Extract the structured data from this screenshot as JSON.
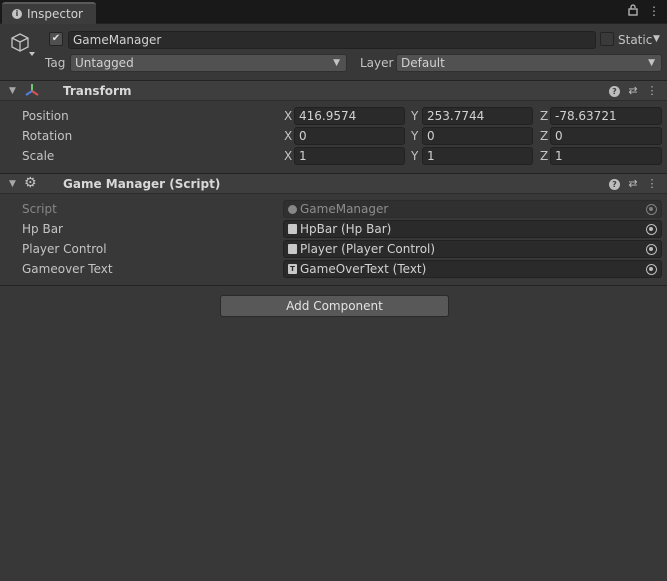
{
  "tab": {
    "title": "Inspector",
    "icons": [
      "lock-icon",
      "more-icon"
    ]
  },
  "gameobject": {
    "active": true,
    "name": "GameManager",
    "static_label": "Static",
    "tag_label": "Tag",
    "tag_value": "Untagged",
    "layer_label": "Layer",
    "layer_value": "Default"
  },
  "transform": {
    "title": "Transform",
    "rows": [
      {
        "label": "Position",
        "x": "416.9574",
        "y": "253.7744",
        "z": "-78.63721"
      },
      {
        "label": "Rotation",
        "x": "0",
        "y": "0",
        "z": "0"
      },
      {
        "label": "Scale",
        "x": "1",
        "y": "1",
        "z": "1"
      }
    ],
    "axis_labels": {
      "x": "X",
      "y": "Y",
      "z": "Z"
    }
  },
  "script_component": {
    "title": "Game Manager (Script)",
    "fields": [
      {
        "label": "Script",
        "value": "GameManager",
        "icon": "script-icon",
        "disabled": true
      },
      {
        "label": "Hp Bar",
        "value": "HpBar (Hp Bar)",
        "icon": "script-icon"
      },
      {
        "label": "Player Control",
        "value": "Player (Player Control)",
        "icon": "script-icon"
      },
      {
        "label": "Gameover Text",
        "value": "GameOverText (Text)",
        "icon": "text-icon"
      }
    ]
  },
  "add_component_label": "Add Component",
  "colors": {
    "background": "#383838",
    "tabbar": "#191919",
    "field": "#2a2a2a",
    "button": "#585858"
  }
}
